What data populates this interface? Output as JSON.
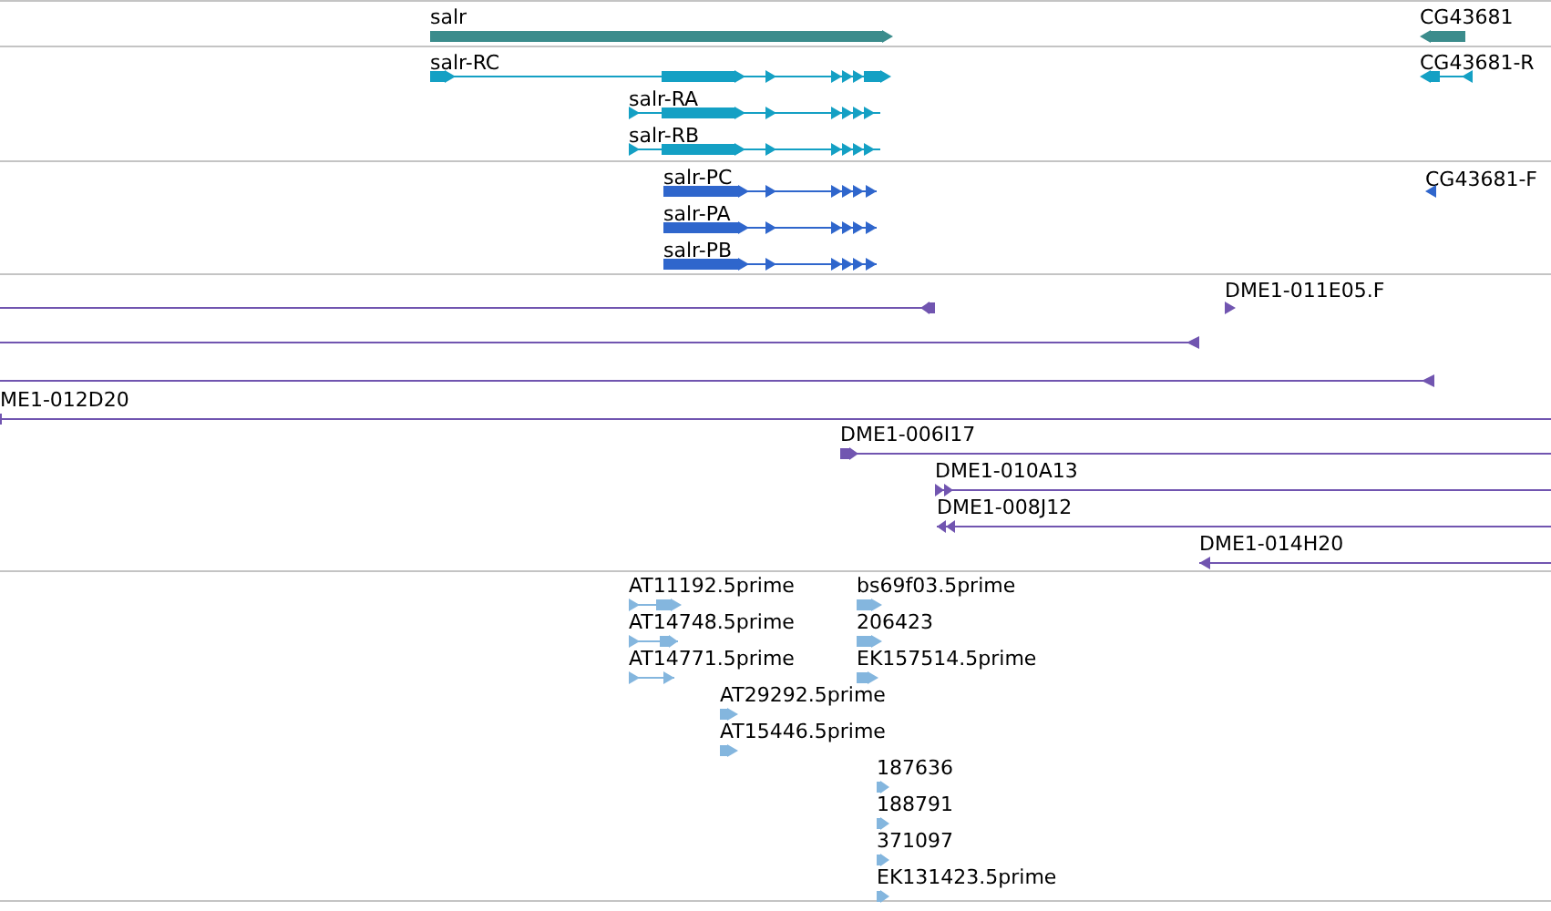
{
  "tracks": [
    {
      "features": [
        {
          "label": "salr",
          "reverse": false
        },
        {
          "label": "CG43681",
          "reverse": true
        }
      ]
    },
    {
      "features": [
        {
          "label": "salr-RC",
          "reverse": false
        },
        {
          "label": "salr-RA",
          "reverse": false
        },
        {
          "label": "salr-RB",
          "reverse": false
        },
        {
          "label": "CG43681-R",
          "reverse": true
        }
      ]
    },
    {
      "features": [
        {
          "label": "salr-PC",
          "reverse": false
        },
        {
          "label": "salr-PA",
          "reverse": false
        },
        {
          "label": "salr-PB",
          "reverse": false
        },
        {
          "label": "CG43681-F",
          "reverse": true
        }
      ]
    },
    {
      "features": [
        {
          "reverse": true
        },
        {
          "label": "DME1-011E05.F",
          "reverse": false
        },
        {
          "reverse": true
        },
        {
          "reverse": true
        },
        {
          "label": "ME1-012D20"
        },
        {
          "label": "DME1-006I17",
          "reverse": false
        },
        {
          "label": "DME1-010A13",
          "reverse": false
        },
        {
          "label": "DME1-008J12",
          "reverse": true
        },
        {
          "label": "DME1-014H20",
          "reverse": true
        }
      ]
    },
    {
      "features": [
        {
          "label": "AT11192.5prime",
          "reverse": false
        },
        {
          "label": "AT14748.5prime",
          "reverse": false
        },
        {
          "label": "AT14771.5prime",
          "reverse": false
        },
        {
          "label": "bs69f03.5prime",
          "reverse": false
        },
        {
          "label": "206423",
          "reverse": false
        },
        {
          "label": "EK157514.5prime",
          "reverse": false
        },
        {
          "label": "AT29292.5prime",
          "reverse": false
        },
        {
          "label": "AT15446.5prime",
          "reverse": false
        },
        {
          "label": "187636",
          "reverse": false
        },
        {
          "label": "188791",
          "reverse": false
        },
        {
          "label": "371097",
          "reverse": false
        },
        {
          "label": "EK131423.5prime",
          "reverse": false
        }
      ]
    }
  ]
}
